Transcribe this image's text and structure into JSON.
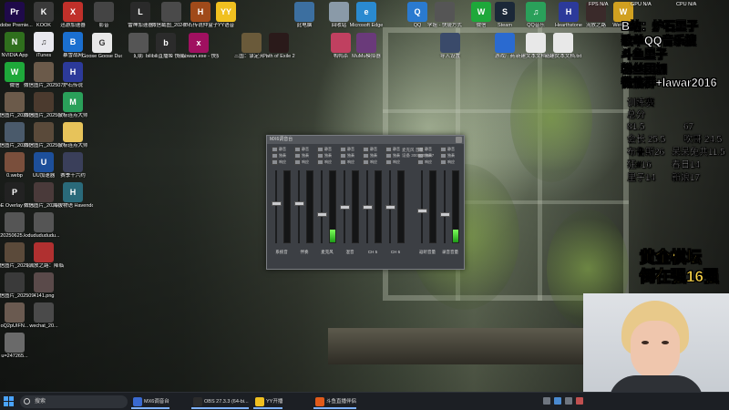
{
  "desktop": {
    "columns": [
      [
        {
          "label": "Adobe Premie...",
          "icon": "premiere-icon",
          "glyph": "Pr",
          "color": "#1f0a4a"
        },
        {
          "label": "NVIDIA App",
          "icon": "nvidia-icon",
          "glyph": "N",
          "color": "#2f6f1d"
        },
        {
          "label": "微信",
          "icon": "wechat-icon",
          "glyph": "W",
          "color": "#1ea83a"
        },
        {
          "label": "微信图片_2025080...",
          "icon": "image-file-icon",
          "glyph": "",
          "color": "#6b5a4a"
        },
        {
          "label": "微信图片_2025072...",
          "icon": "image-file-icon",
          "glyph": "",
          "color": "#4a5a6b"
        },
        {
          "label": "0.webp",
          "icon": "image-file-icon",
          "glyph": "",
          "color": "#7a4f3c"
        },
        {
          "label": "PoE Overlay II Standal...",
          "icon": "poe-overlay-icon",
          "glyph": "P",
          "color": "#222"
        },
        {
          "label": "20250625.kx",
          "icon": "kx-file-icon",
          "glyph": "",
          "color": "#555"
        },
        {
          "label": "微信图片_2025062...",
          "icon": "image-file-icon",
          "glyph": "",
          "color": "#5b4a3a"
        },
        {
          "label": "微信图片_2025091...",
          "icon": "image-file-icon",
          "glyph": "",
          "color": "#3a3a3a"
        },
        {
          "label": "oQ2pUIFN...",
          "icon": "image-file-icon",
          "glyph": "",
          "color": "#6a5a50"
        },
        {
          "label": "u=247265...",
          "icon": "image-file-icon",
          "glyph": "",
          "color": "#6a6a6a"
        }
      ],
      [
        {
          "label": "KOOK",
          "icon": "kook-icon",
          "glyph": "K",
          "color": "#3a3a3a"
        },
        {
          "label": "iTunes",
          "icon": "itunes-icon",
          "glyph": "♫",
          "color": "#e9e9ef"
        },
        {
          "label": "微信图片_2025072...",
          "icon": "image-file-icon",
          "glyph": "",
          "color": "#6b5a4a"
        },
        {
          "label": "微信图片_2025072...",
          "icon": "image-file-icon",
          "glyph": "",
          "color": "#4b3a2e"
        },
        {
          "label": "微信图片_2025071...",
          "icon": "image-file-icon",
          "glyph": "",
          "color": "#5a4a3a"
        },
        {
          "label": "UU加速器",
          "icon": "uu-accelerator-icon",
          "glyph": "U",
          "color": "#1d4f9a"
        },
        {
          "label": "微信图片_2025071...",
          "icon": "image-file-icon",
          "glyph": "",
          "color": "#4a3a3a"
        },
        {
          "label": "dududududu...",
          "icon": "file-icon",
          "glyph": "",
          "color": "#555"
        },
        {
          "label": "《流放之路：降临》超光...",
          "icon": "pdf-icon",
          "glyph": "",
          "color": "#b03030"
        },
        {
          "label": "4141.png",
          "icon": "image-file-icon",
          "glyph": "",
          "color": "#5a4a4a"
        },
        {
          "label": "wechat_20...",
          "icon": "image-file-icon",
          "glyph": "",
          "color": "#4a4a4a"
        }
      ],
      [
        {
          "label": "迅游加速器",
          "icon": "xunyou-icon",
          "glyph": "X",
          "color": "#c0302a"
        },
        {
          "label": "暴雪战网",
          "icon": "battlenet-icon",
          "glyph": "B",
          "color": "#1a6fd0"
        },
        {
          "label": "炉石传说",
          "icon": "hearthstone-icon",
          "glyph": "H",
          "color": "#2c3a9a"
        },
        {
          "label": "鼠标连点大师",
          "icon": "mouse-clicker-icon",
          "glyph": "M",
          "color": "#2aa05a"
        },
        {
          "label": "鼠标连点大师",
          "icon": "folder-icon",
          "glyph": "",
          "color": "#e7c35a"
        },
        {
          "label": "赛季十六约",
          "icon": "image-file-icon",
          "glyph": "",
          "color": "#3a3f5a"
        },
        {
          "label": "海拔物语 Havendock",
          "icon": "havendock-icon",
          "glyph": "H",
          "color": "#2a6a7a"
        }
      ]
    ],
    "row2": [
      {
        "label": "影音",
        "icon": "media-icon",
        "glyph": "",
        "color": "#444"
      },
      {
        "label": "雷神加速器",
        "icon": "leishen-icon",
        "glyph": "L",
        "color": "#2a2a2a"
      },
      {
        "label": "微信截图_2024071...",
        "icon": "image-file-icon",
        "glyph": "",
        "color": "#4a4a4a"
      },
      {
        "label": "炉石传说仲盒子",
        "icon": "hearthstone-box-icon",
        "glyph": "H",
        "color": "#a04a1a"
      },
      {
        "label": "YY语音",
        "icon": "yy-icon",
        "glyph": "YY",
        "color": "#f0c020"
      },
      {
        "label": "Goose Goose Duck",
        "icon": "goose-duck-icon",
        "glyph": "G",
        "color": "#e8e8e8"
      },
      {
        "label": "幻影",
        "icon": "app-icon",
        "glyph": "",
        "color": "#555"
      },
      {
        "label": "bilibili直播姬 快捷方式",
        "icon": "bilibili-icon",
        "glyph": "b",
        "color": "#2b2b2b"
      },
      {
        "label": "xiaowan.exe - 快捷方式",
        "icon": "xiaowan-icon",
        "glyph": "x",
        "color": "#a01060"
      },
      {
        "label": "三国：谋定天下",
        "icon": "sanguo-icon",
        "glyph": "",
        "color": "#6a5a3a"
      },
      {
        "label": "Path of Exile 2",
        "icon": "poe2-icon",
        "glyph": "",
        "color": "#2a1a1a"
      }
    ],
    "top_row": [
      {
        "label": "此电脑",
        "icon": "computer-icon",
        "glyph": "",
        "color": "#3c6fa0"
      },
      {
        "label": "回收站",
        "icon": "recycle-bin-icon",
        "glyph": "",
        "color": "#8a9aa8"
      },
      {
        "label": "Microsoft Edge",
        "icon": "edge-icon",
        "glyph": "e",
        "color": "#2a8ad0"
      },
      {
        "label": "QQ",
        "icon": "qq-icon",
        "glyph": "Q",
        "color": "#2a7ad0"
      },
      {
        "label": "学姐 - 快捷方式",
        "icon": "shortcut-icon",
        "glyph": "",
        "color": "#555"
      },
      {
        "label": "微信",
        "icon": "wechat-icon",
        "glyph": "W",
        "color": "#1ea83a"
      },
      {
        "label": "Steam",
        "icon": "steam-icon",
        "glyph": "S",
        "color": "#1b2838"
      },
      {
        "label": "QQ音乐",
        "icon": "qqmusic-icon",
        "glyph": "♫",
        "color": "#2aa05a"
      },
      {
        "label": "Hearthstone",
        "icon": "hearthstone-icon",
        "glyph": "H",
        "color": "#2c3a9a"
      },
      {
        "label": "流放之路",
        "icon": "poe-icon",
        "glyph": "",
        "color": "#3a2a2a"
      },
      {
        "label": "WeGame",
        "icon": "wegame-icon",
        "glyph": "W",
        "color": "#d0a020"
      }
    ],
    "mid_row": [
      {
        "label": "鸭鸭杀",
        "icon": "game-icon",
        "glyph": "",
        "color": "#c04060"
      },
      {
        "label": "MuMu模拟器",
        "icon": "mumu-icon",
        "glyph": "",
        "color": "#6a3a7a"
      },
      {
        "label": "导入设置",
        "icon": "file-icon",
        "glyph": "",
        "color": "#3a4a6a"
      },
      {
        "label": "游戏厂商",
        "icon": "app-icon",
        "glyph": "",
        "color": "#2a6ad0"
      },
      {
        "label": "新建文本文档 (2).txt",
        "icon": "text-file-icon",
        "glyph": "",
        "color": "#e8e8e8"
      },
      {
        "label": "新建文本文档.txt",
        "icon": "text-file-icon",
        "glyph": "",
        "color": "#e8e8e8"
      }
    ]
  },
  "overlay": {
    "lines": [
      "B站：炉石里子",
      "歌单QQ音乐搜",
      "斗鱼里子",
      "粉丝团加",
      "微信群+lawar2016"
    ],
    "score_title": "训练赛",
    "score_total": "总分",
    "scores": [
      [
        "81.5",
        "67"
      ],
      [
        "会长 25.5",
        "吹哥 24.5"
      ],
      [
        "布鲁斯26",
        "呆呆兔共11.5"
      ],
      [
        "狂#16",
        "春日14"
      ],
      [
        "里子14",
        "新娘17"
      ]
    ],
    "gold": [
      "黄金棋坛",
      "倒在强16强"
    ]
  },
  "tray_top": [
    {
      "label": "FPS",
      "value": "N/A"
    },
    {
      "label": "GPU",
      "value": "N/A"
    },
    {
      "label": "CPU",
      "value": "N/A"
    }
  ],
  "mixer": {
    "title": "MX6调音台",
    "info_lines": [
      "麦克风 音量",
      "设备 3000000587"
    ],
    "strips": [
      {
        "name": "系统音",
        "level": 0.0,
        "fader": 0.55
      },
      {
        "name": "伴奏",
        "level": 0.0,
        "fader": 0.55
      },
      {
        "name": "麦克风",
        "level": 0.18,
        "fader": 0.4
      },
      {
        "name": "混音",
        "level": 0.0,
        "fader": 0.5
      },
      {
        "name": "CH 5",
        "level": 0.0,
        "fader": 0.5
      },
      {
        "name": "CH 6",
        "level": 0.0,
        "fader": 0.5
      },
      {
        "name": "返听音量",
        "level": 0.0,
        "fader": 0.45
      },
      {
        "name": "录音音量",
        "level": 0.18,
        "fader": 0.4
      }
    ],
    "switch_labels": [
      "静音",
      "独奏",
      "响应"
    ]
  },
  "taskbar": {
    "search_placeholder": "搜索",
    "apps": [
      {
        "label": "MX6调音台",
        "icon": "mixer-app-icon",
        "color": "#3a6ad0"
      },
      {
        "label": "OBS 27.3.3 (64-bi...",
        "icon": "obs-icon",
        "color": "#2b2b2b"
      },
      {
        "label": "YY开播",
        "icon": "yy-icon",
        "color": "#f0c020"
      },
      {
        "label": "斗鱼直播伴侣",
        "icon": "douyu-icon",
        "color": "#e05a1a"
      }
    ]
  }
}
